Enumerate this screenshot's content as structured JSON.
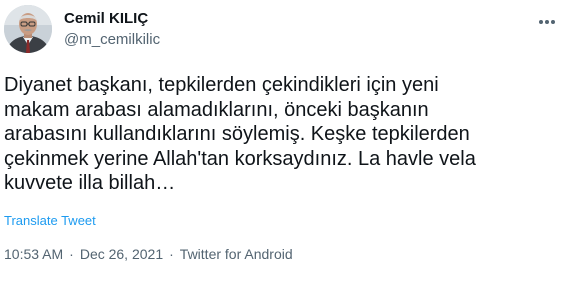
{
  "author": {
    "name": "Cemil KILIÇ",
    "handle": "@m_cemilkilic"
  },
  "tweet": {
    "text": "Diyanet başkanı, tepkilerden çekindikleri için yeni\nmakam arabası alamadıklarını, önceki başkanın\narabasını kullandıklarını söylemiş. Keşke tepkilerden\nçekinmek yerine Allah'tan korksaydınız. La havle vela\nkuvvete illa billah…",
    "translate_label": "Translate Tweet"
  },
  "meta": {
    "time": "10:53 AM",
    "separator": "·",
    "date": "Dec 26, 2021",
    "source": "Twitter for Android"
  },
  "icons": {
    "avatar": "avatar",
    "more": "more-options-icon"
  },
  "colors": {
    "text": "#0f1419",
    "secondary": "#536471",
    "link": "#1d9bf0"
  }
}
